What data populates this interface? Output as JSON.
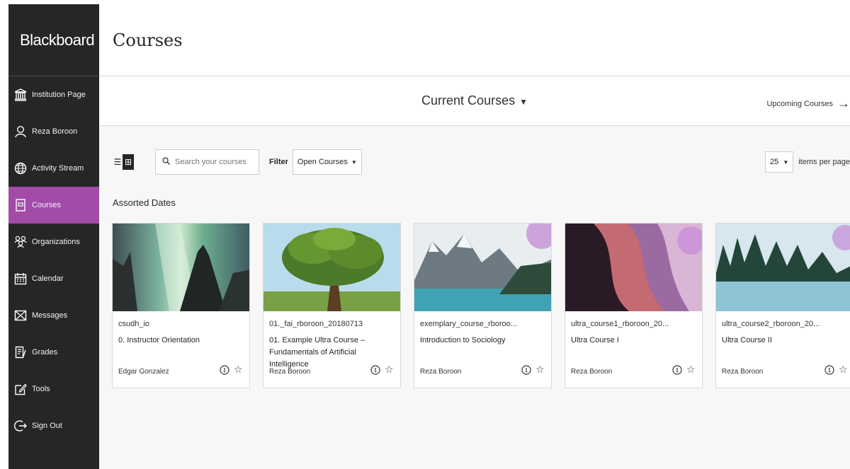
{
  "sidebar": {
    "brand": "Blackboard",
    "items": [
      {
        "label": "Institution Page",
        "icon": "institution-icon"
      },
      {
        "label": "Reza Boroon",
        "icon": "user-icon"
      },
      {
        "label": "Activity Stream",
        "icon": "globe-icon"
      },
      {
        "label": "Courses",
        "icon": "courses-icon",
        "active": true
      },
      {
        "label": "Organizations",
        "icon": "organizations-icon"
      },
      {
        "label": "Calendar",
        "icon": "calendar-icon"
      },
      {
        "label": "Messages",
        "icon": "messages-icon"
      },
      {
        "label": "Grades",
        "icon": "grades-icon"
      },
      {
        "label": "Tools",
        "icon": "tools-icon"
      },
      {
        "label": "Sign Out",
        "icon": "sign-out-icon"
      }
    ],
    "active_color": "#a24ca8"
  },
  "header": {
    "title": "Courses"
  },
  "subbar": {
    "current": "Current Courses",
    "upcoming": "Upcoming Courses"
  },
  "toolbar": {
    "search_placeholder": "Search your courses",
    "filter_label": "Filter",
    "filter_value": "Open Courses",
    "per_page_value": "25",
    "per_page_label": "items per page"
  },
  "section": {
    "title": "Assorted Dates"
  },
  "courses": [
    {
      "code": "csudh_io",
      "name": "0. Instructor Orientation",
      "instructor": "Edgar Gonzalez",
      "image": "aurora"
    },
    {
      "code": "01._fai_rboroon_20180713",
      "name": "01. Example Ultra Course – Fundamentals of Artificial Intelligence",
      "instructor": "Reza Boroon",
      "image": "tree"
    },
    {
      "code": "exemplary_course_rboroo...",
      "name": "Introduction to Sociology",
      "instructor": "Reza Boroon",
      "image": "lake"
    },
    {
      "code": "ultra_course1_rboroon_20...",
      "name": "Ultra Course I",
      "instructor": "Reza Boroon",
      "image": "canyon"
    },
    {
      "code": "ultra_course2_rboroon_20...",
      "name": "Ultra Course II",
      "instructor": "Reza Boroon",
      "image": "forest"
    }
  ]
}
